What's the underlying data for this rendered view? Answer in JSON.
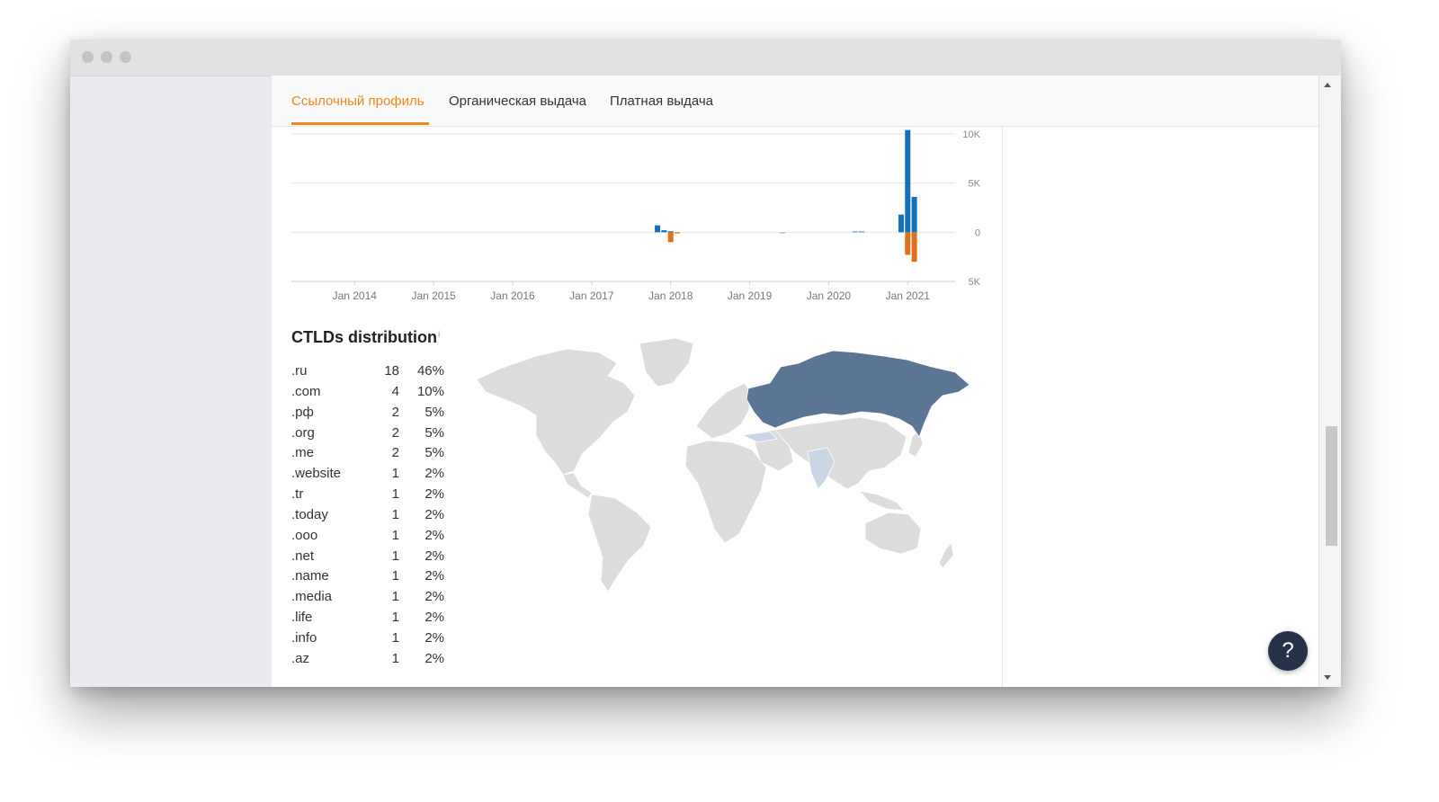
{
  "tabs": [
    {
      "label": "Ссылочный профиль",
      "active": true
    },
    {
      "label": "Органическая выдача",
      "active": false
    },
    {
      "label": "Платная выдача",
      "active": false
    }
  ],
  "chart_data": {
    "type": "bar",
    "x_tick_labels": [
      "Jan 2014",
      "Jan 2015",
      "Jan 2016",
      "Jan 2017",
      "Jan 2018",
      "Jan 2019",
      "Jan 2020",
      "Jan 2021"
    ],
    "y_tick_labels": [
      "10K",
      "5K",
      "0",
      "5K"
    ],
    "ylim": [
      -5000,
      10000
    ],
    "series": [
      {
        "color": "#1271bb",
        "points": [
          {
            "x": "2017-11",
            "y": 700
          },
          {
            "x": "2017-12",
            "y": 200
          },
          {
            "x": "2018-01",
            "y": 100
          },
          {
            "x": "2020-12",
            "y": 1800
          },
          {
            "x": "2021-01",
            "y": 10400
          },
          {
            "x": "2021-02",
            "y": 3600
          }
        ]
      },
      {
        "color": "#6a9bc7",
        "points": [
          {
            "x": "2020-05",
            "y": 100
          },
          {
            "x": "2020-06",
            "y": 100
          }
        ]
      },
      {
        "color": "#e1701e",
        "points": [
          {
            "x": "2018-01",
            "y": -1000
          },
          {
            "x": "2018-02",
            "y": -100
          },
          {
            "x": "2021-01",
            "y": -2300
          },
          {
            "x": "2021-02",
            "y": -3000
          }
        ]
      },
      {
        "color": "#b0b0b0",
        "points": [
          {
            "x": "2019-06",
            "y": -100
          }
        ]
      }
    ]
  },
  "ctld": {
    "title": "CTLDs distribution",
    "info_mark": "i",
    "rows": [
      {
        "tld": ".ru",
        "count": "18",
        "pct": "46%"
      },
      {
        "tld": ".com",
        "count": "4",
        "pct": "10%"
      },
      {
        "tld": ".рф",
        "count": "2",
        "pct": "5%"
      },
      {
        "tld": ".org",
        "count": "2",
        "pct": "5%"
      },
      {
        "tld": ".me",
        "count": "2",
        "pct": "5%"
      },
      {
        "tld": ".website",
        "count": "1",
        "pct": "2%"
      },
      {
        "tld": ".tr",
        "count": "1",
        "pct": "2%"
      },
      {
        "tld": ".today",
        "count": "1",
        "pct": "2%"
      },
      {
        "tld": ".ooo",
        "count": "1",
        "pct": "2%"
      },
      {
        "tld": ".net",
        "count": "1",
        "pct": "2%"
      },
      {
        "tld": ".name",
        "count": "1",
        "pct": "2%"
      },
      {
        "tld": ".media",
        "count": "1",
        "pct": "2%"
      },
      {
        "tld": ".life",
        "count": "1",
        "pct": "2%"
      },
      {
        "tld": ".info",
        "count": "1",
        "pct": "2%"
      },
      {
        "tld": ".az",
        "count": "1",
        "pct": "2%"
      }
    ]
  },
  "map": {
    "highlight_color": "#5b7594",
    "secondary_color": "#c9d5e3",
    "land_color": "#dcdcdc"
  },
  "help": {
    "label": "?"
  }
}
